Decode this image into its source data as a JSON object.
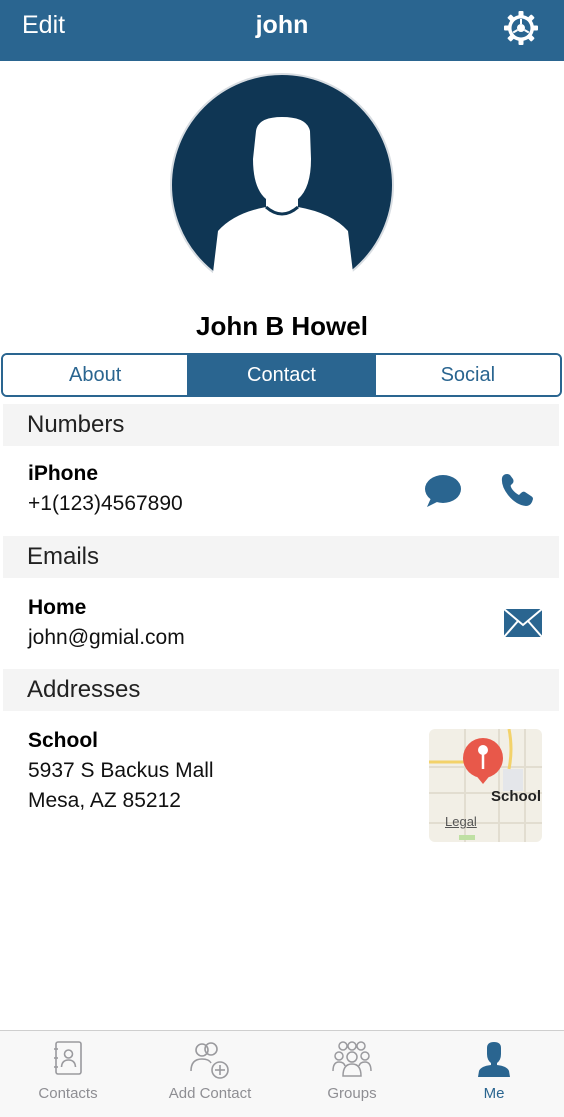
{
  "navbar": {
    "left_label": "Edit",
    "title": "john",
    "settings_icon": "gear-icon"
  },
  "profile": {
    "name": "John B Howel",
    "avatar_icon": "person-avatar-icon"
  },
  "segments": [
    {
      "label": "About",
      "active": false
    },
    {
      "label": "Contact",
      "active": true
    },
    {
      "label": "Social",
      "active": false
    }
  ],
  "numbers": {
    "header": "Numbers",
    "label": "iPhone",
    "value": "+1(123)4567890",
    "message_icon": "chat-bubble-icon",
    "call_icon": "phone-icon"
  },
  "emails": {
    "header": "Emails",
    "label": "Home",
    "value": "john@gmial.com",
    "mail_icon": "envelope-icon"
  },
  "addresses": {
    "header": "Addresses",
    "label": "School",
    "line1": "5937 S Backus Mall",
    "line2": "Mesa, AZ 85212",
    "map": {
      "pin_label": "School",
      "legal_label": "Legal"
    }
  },
  "tabbar": {
    "items": [
      {
        "label": "Contacts",
        "icon": "address-book-icon",
        "active": false
      },
      {
        "label": "Add Contact",
        "icon": "add-person-icon",
        "active": false
      },
      {
        "label": "Groups",
        "icon": "group-icon",
        "active": false
      },
      {
        "label": "Me",
        "icon": "person-icon",
        "active": true
      }
    ]
  },
  "colors": {
    "accent": "#2a6590",
    "avatar": "#0f3654",
    "map_pin": "#e8584a"
  }
}
